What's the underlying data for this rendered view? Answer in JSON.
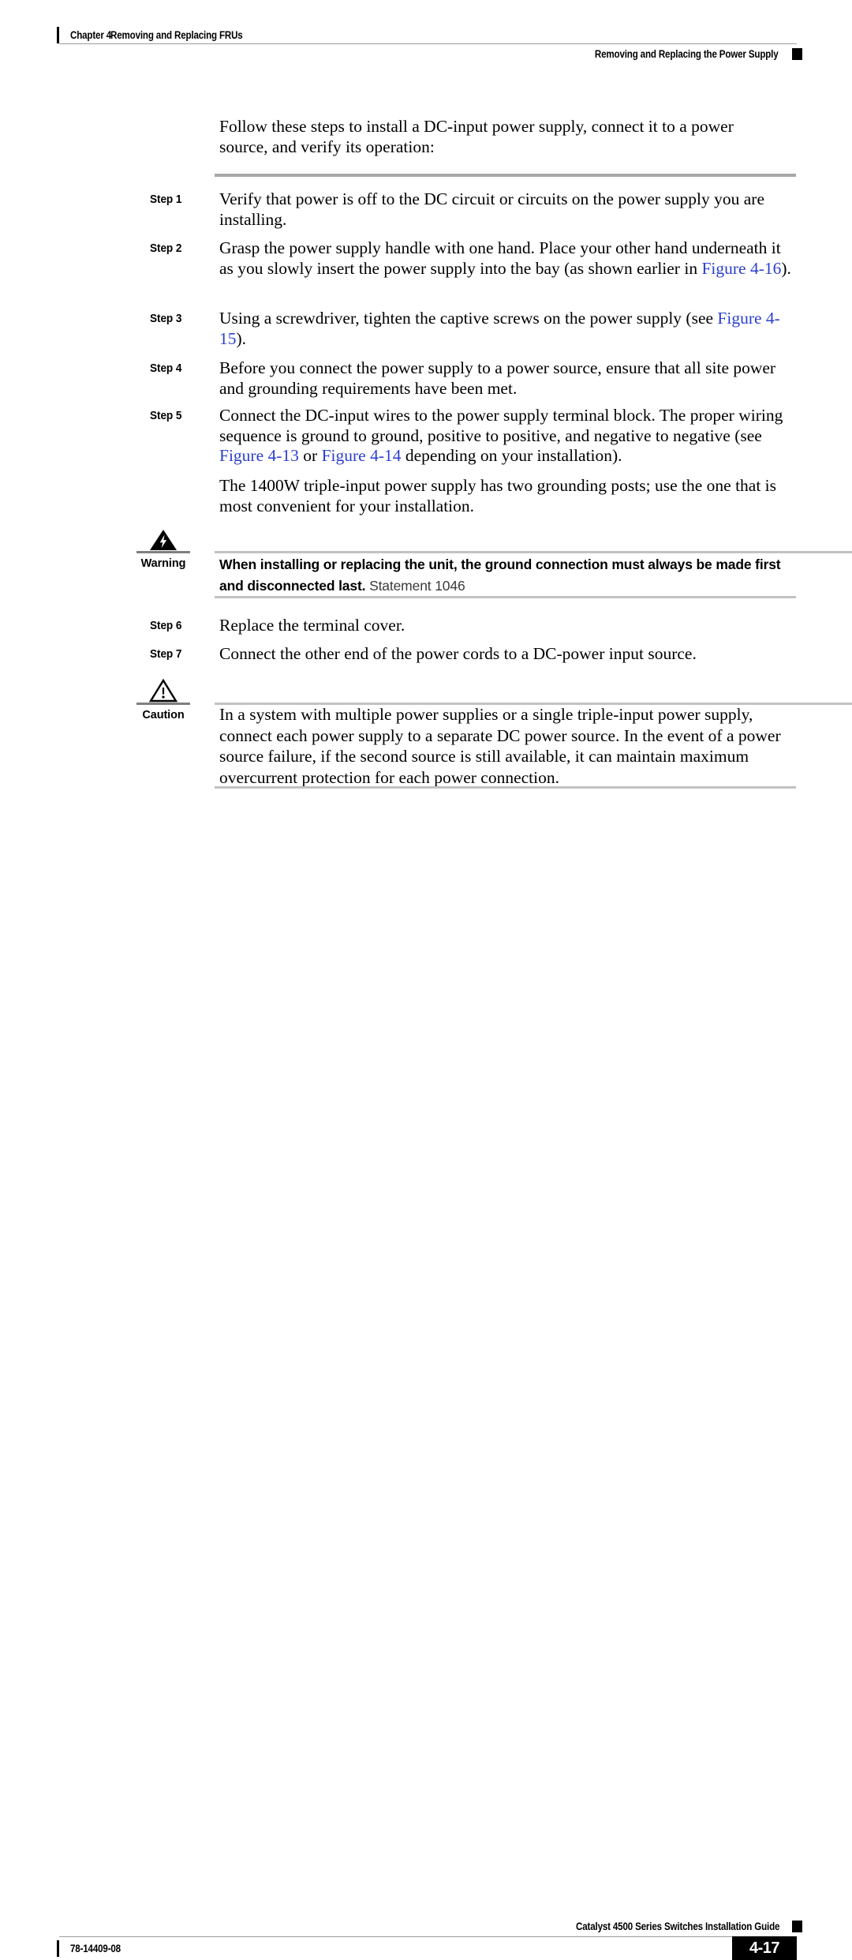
{
  "header": {
    "chapter_label": "Chapter 4",
    "chapter_title": "Removing and Replacing FRUs",
    "section_title": "Removing and Replacing the Power Supply"
  },
  "body": {
    "intro": "Follow these steps to install a DC-input power supply, connect it to a power source, and verify its operation:",
    "steps": [
      {
        "label": "Step 1",
        "text": "Verify that power is off to the DC circuit or circuits on the power supply you are installing."
      },
      {
        "label": "Step 2",
        "text_before": "Grasp the power supply handle with one hand. Place your other hand underneath it as you slowly insert the power supply into the bay (as shown earlier in ",
        "link1": "Figure 4-16",
        "text_after": ")."
      },
      {
        "label": "Step 3",
        "text_before": "Using a screwdriver, tighten the captive screws on the power supply (see ",
        "link1": "Figure 4-15",
        "text_after": ")."
      },
      {
        "label": "Step 4",
        "text": "Before you connect the power supply to a power source, ensure that all site power and grounding requirements have been met."
      },
      {
        "label": "Step 5",
        "text_before": "Connect the DC-input wires to the power supply terminal block. The proper wiring sequence is ground to ground, positive to positive, and negative to negative (see ",
        "link1": "Figure 4-13",
        "text_middle": " or ",
        "link2": "Figure 4-14",
        "text_after": " depending on your installation)."
      },
      {
        "label": "Step 6",
        "text": "Replace the terminal cover."
      },
      {
        "label": "Step 7",
        "text": "Connect the other end of the power cords to a DC-power input source."
      }
    ],
    "step5_extra": "The 1400W triple-input power supply has two grounding posts; use the one that is most convenient for your installation.",
    "warning": {
      "label": "Warning",
      "icon": "warning-lightning-triangle-icon",
      "bold_text": "When installing or replacing the unit, the ground connection must always be made first and disconnected last.",
      "statement": " Statement 1046"
    },
    "caution": {
      "label": "Caution",
      "icon": "caution-exclamation-triangle-icon",
      "text": "In a system with multiple power supplies or a single triple-input power supply, connect each power supply to a separate DC power source. In the event of a power source failure, if the second source is still available, it can maintain maximum overcurrent protection for each power connection."
    }
  },
  "footer": {
    "guide_title": "Catalyst 4500 Series Switches Installation Guide",
    "document_number": "78-14409-08",
    "page_number": "4-17"
  },
  "colors": {
    "link": "#2b3fd0",
    "rule": "#a8a8a8",
    "rule_light": "#c2c2c2",
    "ink": "#000000"
  }
}
